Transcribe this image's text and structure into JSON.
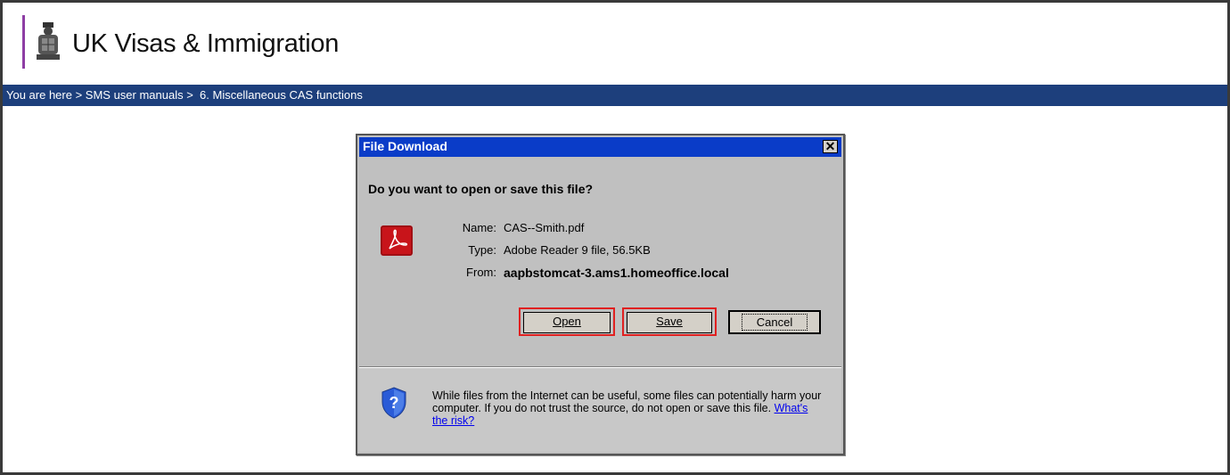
{
  "header": {
    "title": "UK Visas & Immigration"
  },
  "breadcrumb": {
    "text": "You are here > SMS user manuals >  6. Miscellaneous CAS functions"
  },
  "dialog": {
    "title": "File Download",
    "close_label": "✕",
    "question": "Do you want to open or save this file?",
    "file": {
      "name_label": "Name:",
      "name_value": "CAS--Smith.pdf",
      "type_label": "Type:",
      "type_value": "Adobe Reader 9 file, 56.5KB",
      "from_label": "From:",
      "from_value": "aapbstomcat-3.ams1.homeoffice.local"
    },
    "buttons": {
      "open": "Open",
      "save": "Save",
      "cancel": "Cancel"
    },
    "warning": {
      "text": "While files from the Internet can be useful, some files can potentially harm your computer. If you do not trust the source, do not open or save this file.",
      "link": "What's the risk?"
    }
  },
  "colors": {
    "breadcrumb_bg": "#1d3f7c",
    "brand_bar": "#8e3ea4",
    "dialog_title_bg": "#0a3cc8",
    "highlight": "#e02020"
  }
}
